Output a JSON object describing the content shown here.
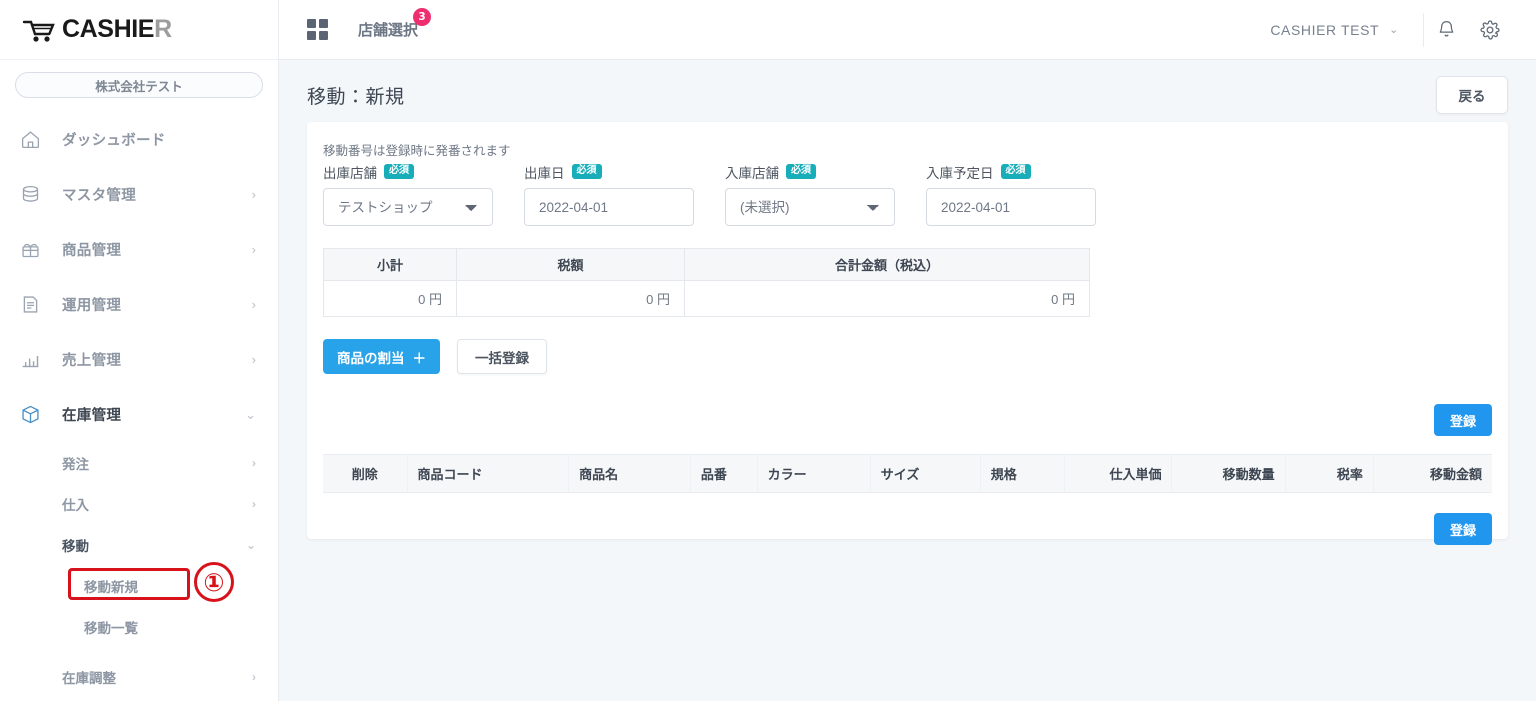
{
  "brand": {
    "name_main": "CASHIE",
    "name_accent": "R",
    "icon": "shopping-cart-icon"
  },
  "sidebar": {
    "company": "株式会社テスト",
    "items": [
      {
        "label": "ダッシュボード",
        "icon": "home-icon",
        "chevron": "",
        "active": false
      },
      {
        "label": "マスタ管理",
        "icon": "database-icon",
        "chevron": "›",
        "active": false
      },
      {
        "label": "商品管理",
        "icon": "gift-icon",
        "chevron": "›",
        "active": false
      },
      {
        "label": "運用管理",
        "icon": "document-icon",
        "chevron": "›",
        "active": false
      },
      {
        "label": "売上管理",
        "icon": "bar-chart-icon",
        "chevron": "›",
        "active": false
      },
      {
        "label": "在庫管理",
        "icon": "box-icon",
        "chevron": "⌄",
        "active": true
      }
    ],
    "sub_items": [
      {
        "label": "発注",
        "chevron": "›"
      },
      {
        "label": "仕入",
        "chevron": "›"
      },
      {
        "label": "移動",
        "chevron": "⌄"
      }
    ],
    "move_children": [
      {
        "label": "移動新規",
        "highlighted": true
      },
      {
        "label": "移動一覧",
        "highlighted": false
      }
    ],
    "tail_items": [
      {
        "label": "在庫調整",
        "chevron": "›"
      }
    ],
    "annotation_number": "①"
  },
  "topbar": {
    "grid_icon": "grid-icon",
    "store_select_label": "店舗選択",
    "store_badge_count": "3",
    "user_name": "CASHIER TEST",
    "caret": "⌄",
    "bell_icon": "bell-icon",
    "gear_icon": "gear-icon"
  },
  "page": {
    "title": "移動：新規",
    "back_button": "戻る",
    "hint": "移動番号は登録時に発番されます"
  },
  "form": {
    "required_badge": "必須",
    "fields": [
      {
        "label": "出庫店舗",
        "type": "select",
        "value": "テストショップ"
      },
      {
        "label": "出庫日",
        "type": "date",
        "value": "2022-04-01"
      },
      {
        "label": "入庫店舗",
        "type": "select",
        "value": "(未選択)"
      },
      {
        "label": "入庫予定日",
        "type": "date",
        "value": "2022-04-01"
      }
    ]
  },
  "summary": {
    "headers": [
      "小計",
      "税額",
      "合計金額（税込）"
    ],
    "values": [
      "0 円",
      "0 円",
      "0 円"
    ]
  },
  "actions": {
    "assign_product": "商品の割当",
    "assign_product_plus": "＋",
    "bulk_register": "一括登録",
    "register_top": "登録",
    "register_bottom": "登録"
  },
  "items_table": {
    "headers": [
      "削除",
      "商品コード",
      "商品名",
      "品番",
      "カラー",
      "サイズ",
      "規格",
      "仕入単価",
      "移動数量",
      "税率",
      "移動金額"
    ],
    "rows": []
  },
  "colors": {
    "accent_blue": "#2196ee",
    "required_teal": "#18aeb9",
    "badge_pink": "#ef2e70",
    "highlight_red": "#d8121a",
    "page_bg": "#f4f7fa"
  }
}
